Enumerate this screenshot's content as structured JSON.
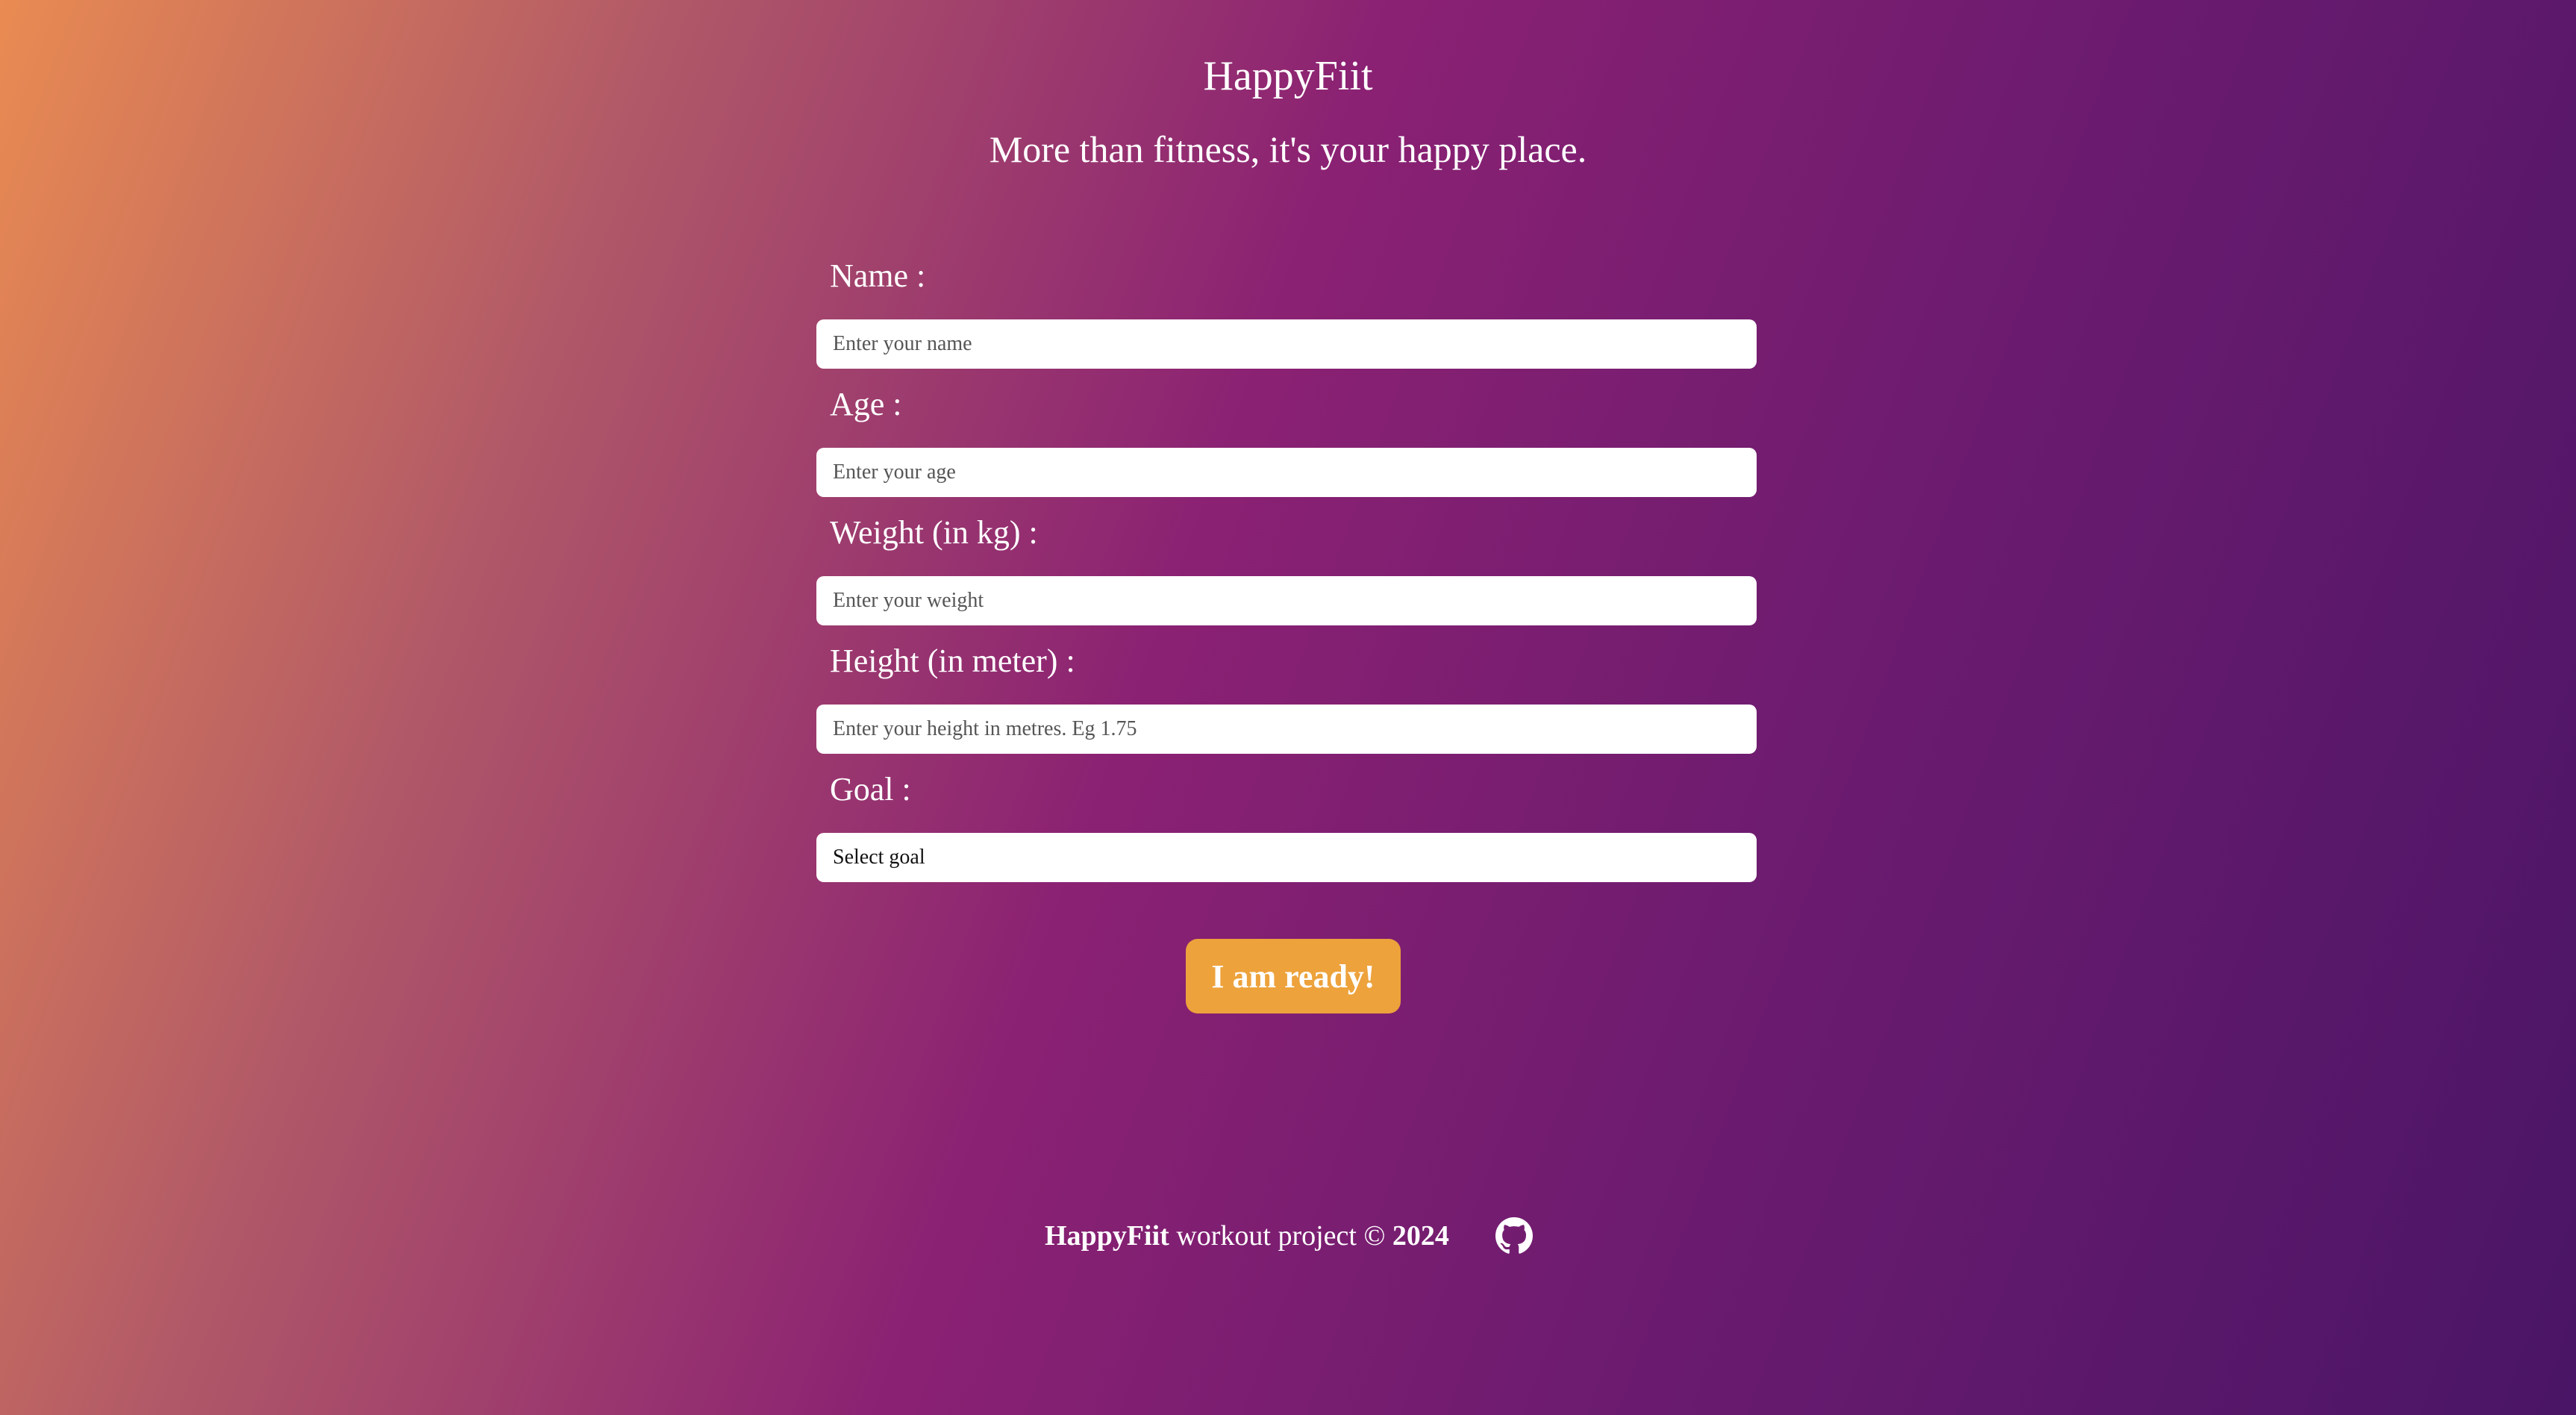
{
  "header": {
    "title": "HappyFiit",
    "tagline": "More than fitness, it's your happy place."
  },
  "form": {
    "name": {
      "label": "Name :",
      "placeholder": "Enter your name",
      "value": ""
    },
    "age": {
      "label": "Age :",
      "placeholder": "Enter your age",
      "value": ""
    },
    "weight": {
      "label": "Weight (in kg) :",
      "placeholder": "Enter your weight",
      "value": ""
    },
    "height": {
      "label": "Height (in meter) :",
      "placeholder": "Enter your height in metres. Eg 1.75",
      "value": ""
    },
    "goal": {
      "label": "Goal :",
      "selected": "Select goal"
    },
    "submit_label": "I am ready!"
  },
  "footer": {
    "brand": "HappyFiit",
    "text": " workout project © ",
    "year": "2024",
    "icon": "github-icon"
  },
  "colors": {
    "background_start": "#e98b52",
    "background_mid": "#8b2173",
    "background_end": "#4a1566",
    "button": "#eda23c",
    "text": "#ffffff"
  }
}
